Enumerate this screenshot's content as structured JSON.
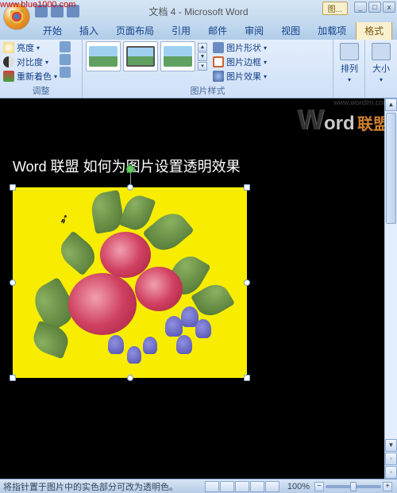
{
  "watermark_url": "www.blue1000.com",
  "title": "文档 4 - Microsoft Word",
  "context_tool_label": "图...",
  "window_buttons": {
    "min": "_",
    "max": "□",
    "close": "x"
  },
  "tabs": {
    "items": [
      "开始",
      "插入",
      "页面布局",
      "引用",
      "邮件",
      "审阅",
      "视图",
      "加载项",
      "格式"
    ],
    "active_index": 8
  },
  "ribbon": {
    "adjust": {
      "brightness": "亮度",
      "contrast": "对比度",
      "recolor": "重新着色",
      "title": "调整"
    },
    "picture_styles": {
      "title": "图片样式",
      "shape": "图片形状",
      "border": "图片边框",
      "effects": "图片效果"
    },
    "arrange_label": "排列",
    "size_label": "大小"
  },
  "document": {
    "watermark_w": "W",
    "watermark_ord": "ord",
    "watermark_cn": "联盟",
    "watermark_site": "www.wordlm.com",
    "heading": "Word 联盟  如何为图片设置透明效果"
  },
  "statusbar": {
    "hint": "将指针置于图片中的实色部分可改为透明色。",
    "zoom": "100%",
    "minus": "−",
    "plus": "+"
  }
}
